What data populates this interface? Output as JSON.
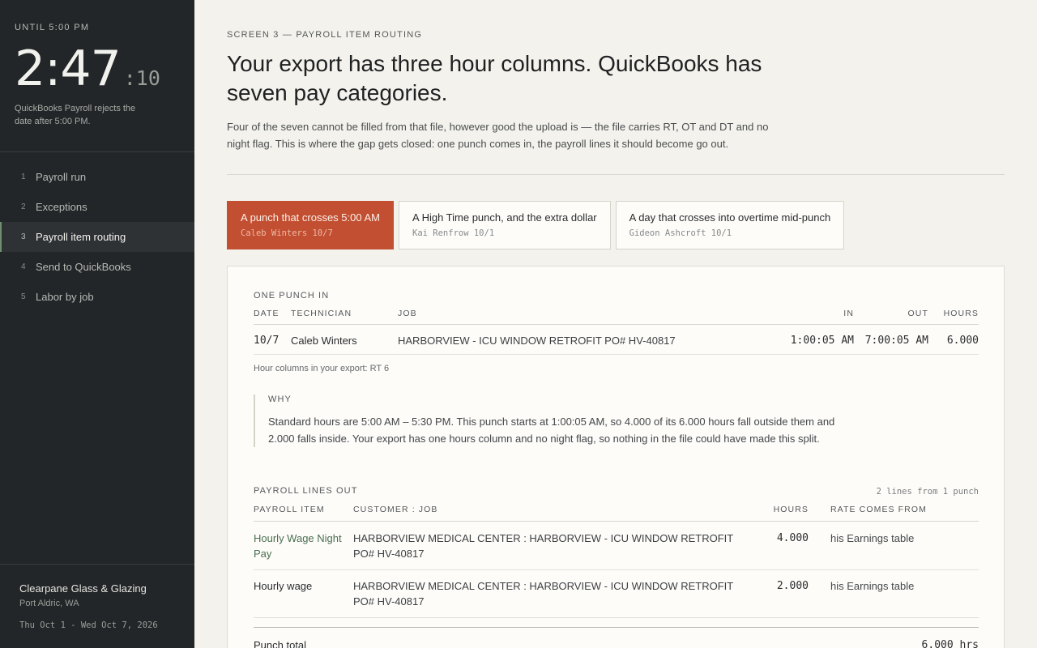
{
  "sidebar": {
    "until": "UNTIL 5:00 PM",
    "clock_main": "2:47",
    "clock_seconds": ":10",
    "reject_note": "QuickBooks Payroll rejects the date after 5:00 PM.",
    "nav": [
      {
        "num": "1",
        "label": "Payroll run"
      },
      {
        "num": "2",
        "label": "Exceptions"
      },
      {
        "num": "3",
        "label": "Payroll item routing"
      },
      {
        "num": "4",
        "label": "Send to QuickBooks"
      },
      {
        "num": "5",
        "label": "Labor by job"
      }
    ],
    "active_index": 2,
    "company": "Clearpane Glass & Glazing",
    "location": "Port Aldric, WA",
    "date_range": "Thu Oct 1 - Wed Oct 7, 2026"
  },
  "main": {
    "eyebrow": "SCREEN 3 — PAYROLL ITEM ROUTING",
    "headline": "Your export has three hour columns. QuickBooks has seven pay categories.",
    "lede": "Four of the seven cannot be filled from that file, however good the upload is — the file carries RT, OT and DT and no night flag. This is where the gap gets closed: one punch comes in, the payroll lines it should become go out.",
    "tabs": [
      {
        "title": "A punch that crosses 5:00 AM",
        "sub": "Caleb Winters 10/7"
      },
      {
        "title": "A High Time punch, and the extra dollar",
        "sub": "Kai Renfrow 10/1"
      },
      {
        "title": "A day that crosses into overtime mid-punch",
        "sub": "Gideon Ashcroft 10/1"
      }
    ]
  },
  "punch": {
    "label": "ONE PUNCH IN",
    "headers": {
      "date": "DATE",
      "tech": "TECHNICIAN",
      "job": "JOB",
      "in": "IN",
      "out": "OUT",
      "hours": "HOURS"
    },
    "row": {
      "date": "10/7",
      "tech": "Caleb Winters",
      "job": "HARBORVIEW - ICU WINDOW RETROFIT  PO# HV-40817",
      "in": "1:00:05 AM",
      "out": "7:00:05 AM",
      "hours": "6.000"
    },
    "hour_columns": "Hour columns in your export: RT 6"
  },
  "why": {
    "title": "WHY",
    "text": "Standard hours are 5:00 AM – 5:30 PM. This punch starts at 1:00:05 AM, so 4.000 of its 6.000 hours fall outside them and 2.000 falls inside. Your export has one hours column and no night flag, so nothing in the file could have made this split."
  },
  "lines": {
    "label": "PAYROLL LINES OUT",
    "count": "2 lines from 1 punch",
    "headers": {
      "item": "PAYROLL ITEM",
      "customer": "CUSTOMER : JOB",
      "hours": "HOURS",
      "rate": "RATE COMES FROM"
    },
    "rows": [
      {
        "item": "Hourly Wage Night Pay",
        "customer": "HARBORVIEW MEDICAL CENTER : HARBORVIEW - ICU WINDOW RETROFIT PO# HV-40817",
        "hours": "4.000",
        "rate": "his Earnings table"
      },
      {
        "item": "Hourly wage",
        "customer": "HARBORVIEW MEDICAL CENTER : HARBORVIEW - ICU WINDOW RETROFIT PO# HV-40817",
        "hours": "2.000",
        "rate": "his Earnings table"
      }
    ],
    "total_label": "Punch total",
    "total_value": "6.000 hrs"
  },
  "colors": {
    "accent": "#c24f31",
    "sidebar_bg": "#232628",
    "night_item": "#4b6f4f"
  }
}
